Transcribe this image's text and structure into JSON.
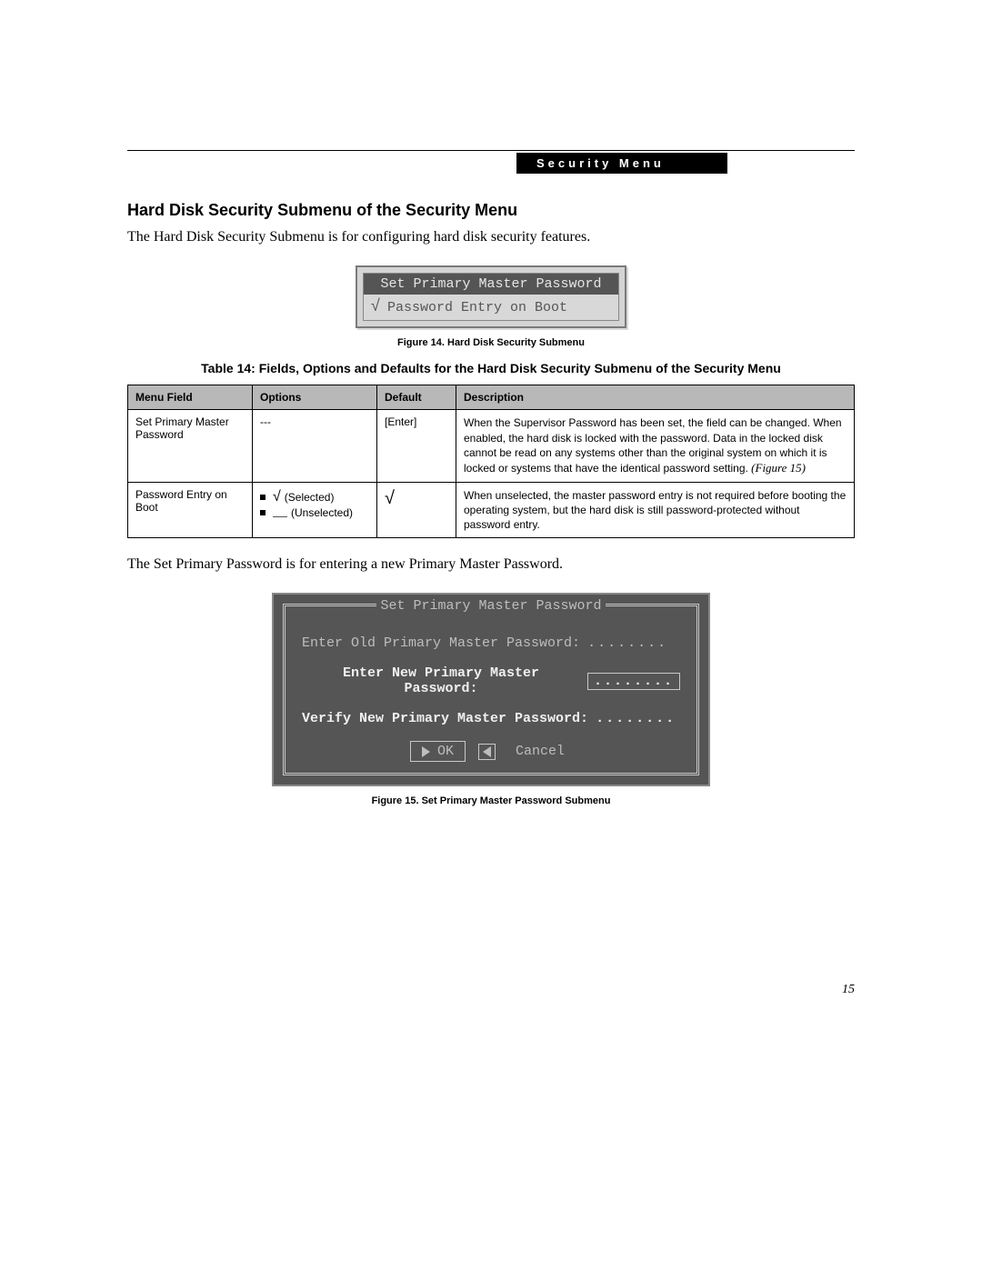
{
  "header": {
    "label": "Security Menu"
  },
  "section": {
    "title": "Hard Disk Security Submenu of the Security Menu",
    "intro": "The Hard Disk Security Submenu is for configuring hard disk security features."
  },
  "figure14": {
    "row1": "Set Primary Master Password",
    "row2": "Password Entry on Boot",
    "check": "√",
    "caption": "Figure 14.   Hard Disk Security Submenu"
  },
  "table": {
    "title": "Table 14: Fields, Options and Defaults for the Hard Disk Security Submenu of the Security Menu",
    "headers": [
      "Menu Field",
      "Options",
      "Default",
      "Description"
    ],
    "rows": [
      {
        "menu": "Set Primary Master Password",
        "options_text": "---",
        "default": "[Enter]",
        "description": "When the Supervisor Password has been set, the field can be changed. When enabled, the hard disk is locked with the password. Data in the locked disk cannot be read on any systems other than the original system on which it is locked or systems that have the identical password setting.",
        "figure_ref": "(Figure 15)"
      },
      {
        "menu": "Password Entry on Boot",
        "option_selected": "(Selected)",
        "option_unselected": "(Unselected)",
        "default_check": "√",
        "description": "When unselected, the master password entry is not required before booting the operating system, but the hard disk is still password-protected without password entry."
      }
    ]
  },
  "midtext": "The Set Primary Password is for entering a new Primary Master Password.",
  "figure15": {
    "title": "Set Primary Master Password",
    "line1": "Enter Old Primary Master Password:",
    "line2": "Enter New Primary Master Password:",
    "line3": "Verify New Primary Master Password:",
    "dots": "........",
    "ok": "OK",
    "cancel": "Cancel",
    "caption": "Figure 15.   Set Primary Master Password Submenu"
  },
  "page_number": "15"
}
